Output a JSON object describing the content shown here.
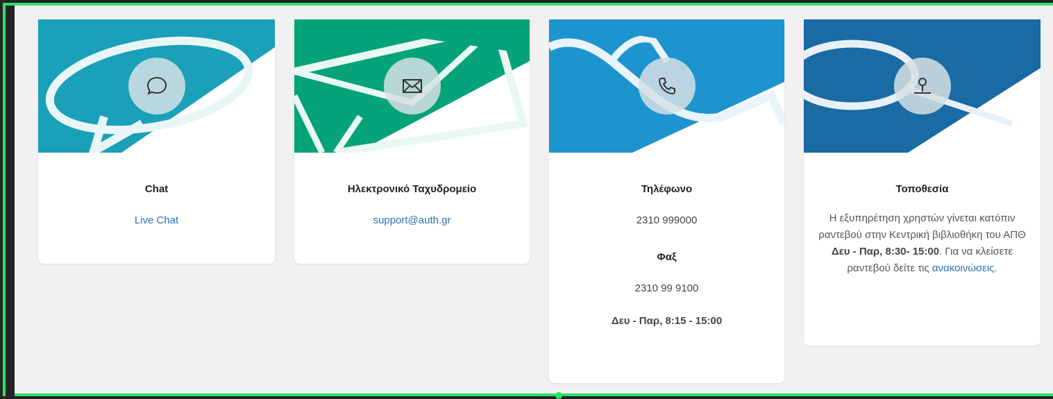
{
  "cards": {
    "chat": {
      "title": "Chat",
      "link_label": "Live Chat",
      "icon": "speech-bubble-icon",
      "color": "#1aa0b8"
    },
    "email": {
      "title": "Ηλεκτρονικό Ταχυδρομείο",
      "link_label": "support@auth.gr",
      "icon": "envelope-icon",
      "color": "#06a37a"
    },
    "phone": {
      "title": "Τηλέφωνο",
      "phone_number": "2310 999000",
      "fax_title": "Φαξ",
      "fax_number": "2310 99 9100",
      "hours": "Δευ - Παρ, 8:15 - 15:00",
      "icon": "phone-icon",
      "color": "#1e94cf"
    },
    "location": {
      "title": "Τοποθεσία",
      "text_1": "Η εξυπηρέτηση χρηστών γίνεται κατόπιν ραντεβού στην Κεντρική βιβλιοθήκη του ΑΠΘ ",
      "hours_bold": "Δευ - Παρ, 8:30- 15:00",
      "text_2": ". Για να κλείσετε ραντεβού δείτε τις ",
      "link_label": "ανακοινώσεις",
      "text_3": ".",
      "icon": "map-pin-icon",
      "color": "#1a6aa3"
    }
  }
}
